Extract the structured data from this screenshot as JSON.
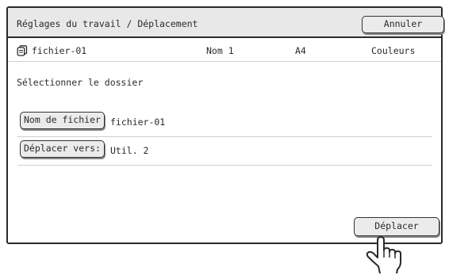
{
  "dialog": {
    "title": "Réglages du travail / Déplacement",
    "cancel_label": "Annuler"
  },
  "job": {
    "icon": "document-stack-icon",
    "file_name": "fichier-01",
    "user": "Nom 1",
    "paper_size": "A4",
    "color_mode": "Couleurs"
  },
  "instruction": "Sélectionner le dossier",
  "fields": {
    "file_name_label": "Nom de fichier",
    "file_name_value": "fichier-01",
    "move_to_label": "Déplacer vers:",
    "move_to_value": "Util. 2"
  },
  "actions": {
    "move_label": "Déplacer"
  }
}
